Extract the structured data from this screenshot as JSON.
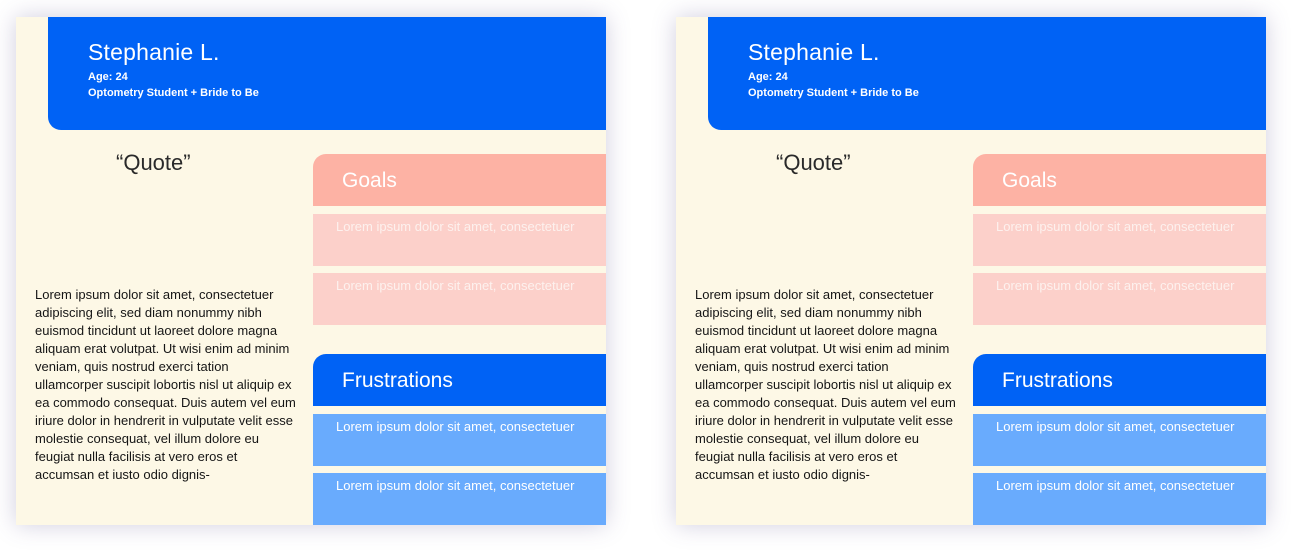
{
  "persona": {
    "name": "Stephanie L.",
    "age": "Age: 24",
    "occupation": "Optometry Student + Bride to Be",
    "quote": "“Quote”",
    "bio": "Lorem ipsum dolor sit amet, consectetuer adipiscing elit, sed diam nonummy nibh euismod tincidunt ut laoreet dolore magna aliquam erat volutpat. Ut wisi enim ad minim veniam, quis nostrud exerci tation ullamcorper suscipit lobortis nisl ut aliquip ex ea commodo consequat. Duis autem vel eum iriure dolor in hendrerit in vulputate velit esse molestie consequat, vel illum dolore eu feugiat nulla facilisis at vero eros et accumsan et iusto odio dignis-"
  },
  "goals": {
    "title": "Goals",
    "items": [
      "Lorem ipsum dolor sit amet, consectetuer",
      "Lorem ipsum dolor sit amet, consectetuer"
    ]
  },
  "frustrations": {
    "title": "Frustrations",
    "items": [
      "Lorem ipsum dolor sit amet, consectetuer",
      "Lorem ipsum dolor sit amet, consectetuer"
    ]
  },
  "colors": {
    "primary_blue": "#0062f5",
    "goals_header": "#fdb2a4",
    "goals_item": "#fcd0ca",
    "frustrations_item": "#69abfd",
    "card_background": "#fdf8e6"
  }
}
